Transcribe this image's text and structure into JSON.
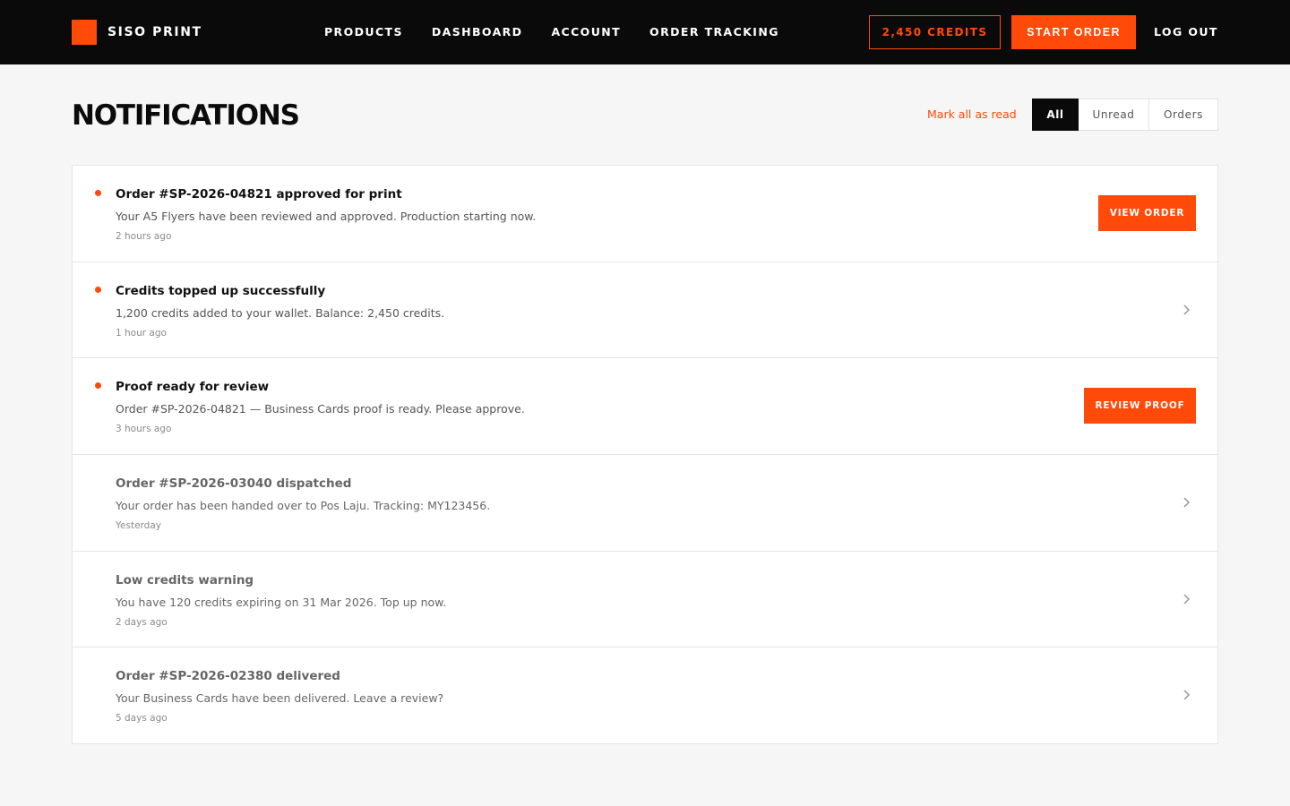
{
  "brand": {
    "name": "SISO PRINT",
    "accent": "#ff4a0a"
  },
  "nav": {
    "links": [
      "PRODUCTS",
      "DASHBOARD",
      "ACCOUNT",
      "ORDER TRACKING"
    ],
    "credits_label": "2,450 CREDITS",
    "start_order_label": "START ORDER",
    "logout_label": "LOG OUT"
  },
  "header": {
    "title": "NOTIFICATIONS",
    "mark_all_read": "Mark all as read",
    "filters": [
      "All",
      "Unread",
      "Orders"
    ],
    "active_filter": "All"
  },
  "notifications": [
    {
      "title": "Order #SP-2026-04821 approved for print",
      "body": "Your A5 Flyers have been reviewed and approved. Production starting now.",
      "time": "2 hours ago",
      "unread": true,
      "action": "VIEW ORDER"
    },
    {
      "title": "Credits topped up successfully",
      "body": "1,200 credits added to your wallet. Balance: 2,450 credits.",
      "time": "1 hour ago",
      "unread": true,
      "action": ""
    },
    {
      "title": "Proof ready for review",
      "body": "Order #SP-2026-04821 — Business Cards proof is ready. Please approve.",
      "time": "3 hours ago",
      "unread": true,
      "action": "REVIEW PROOF"
    },
    {
      "title": "Order #SP-2026-03040 dispatched",
      "body": "Your order has been handed over to Pos Laju. Tracking: MY123456.",
      "time": "Yesterday",
      "unread": false,
      "action": ""
    },
    {
      "title": "Low credits warning",
      "body": "You have 120 credits expiring on 31 Mar 2026. Top up now.",
      "time": "2 days ago",
      "unread": false,
      "action": ""
    },
    {
      "title": "Order #SP-2026-02380 delivered",
      "body": "Your Business Cards have been delivered. Leave a review?",
      "time": "5 days ago",
      "unread": false,
      "action": ""
    }
  ]
}
